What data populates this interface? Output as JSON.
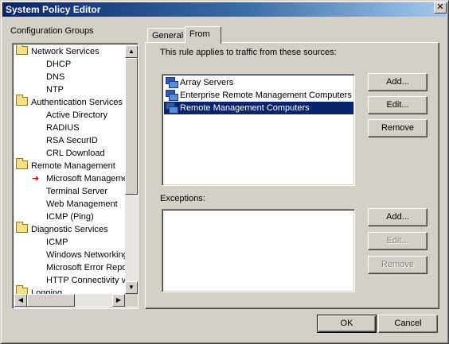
{
  "window": {
    "title": "System Policy Editor",
    "close_glyph": "✕"
  },
  "left": {
    "label": "Configuration Groups",
    "tree": [
      {
        "text": "Network Services",
        "level": 0,
        "icon": "folder-icon"
      },
      {
        "text": "DHCP",
        "level": 1
      },
      {
        "text": "DNS",
        "level": 1
      },
      {
        "text": "NTP",
        "level": 1
      },
      {
        "text": "Authentication Services",
        "level": 0,
        "icon": "folder-icon"
      },
      {
        "text": "Active Directory",
        "level": 1
      },
      {
        "text": "RADIUS",
        "level": 1
      },
      {
        "text": "RSA SecurID",
        "level": 1
      },
      {
        "text": "CRL Download",
        "level": 1
      },
      {
        "text": "Remote Management",
        "level": 0,
        "icon": "folder-icon"
      },
      {
        "text": "Microsoft Manageme",
        "level": 1,
        "marker": "red-arrow-icon"
      },
      {
        "text": "Terminal Server",
        "level": 1
      },
      {
        "text": "Web Management",
        "level": 1
      },
      {
        "text": "ICMP (Ping)",
        "level": 1
      },
      {
        "text": "Diagnostic Services",
        "level": 0,
        "icon": "folder-icon"
      },
      {
        "text": "ICMP",
        "level": 1
      },
      {
        "text": "Windows Networking",
        "level": 1
      },
      {
        "text": "Microsoft Error Repo",
        "level": 1
      },
      {
        "text": "HTTP Connectivity ve",
        "level": 1
      },
      {
        "text": "Logging",
        "level": 0,
        "icon": "folder-icon"
      }
    ]
  },
  "tabs": [
    {
      "label": "General",
      "active": false
    },
    {
      "label": "From",
      "active": true
    }
  ],
  "from_panel": {
    "intro": "This rule applies to traffic from these sources:",
    "sources": [
      {
        "text": "Array Servers",
        "selected": false
      },
      {
        "text": "Enterprise Remote Management Computers",
        "selected": false
      },
      {
        "text": "Remote Management Computers",
        "selected": true
      }
    ],
    "source_buttons": {
      "add": "Add...",
      "edit": "Edit...",
      "remove": "Remove"
    },
    "exceptions_label": "Exceptions:",
    "exceptions": [],
    "exception_buttons": {
      "add": "Add...",
      "edit": "Edit...",
      "remove": "Remove"
    }
  },
  "footer": {
    "ok": "OK",
    "cancel": "Cancel"
  },
  "colors": {
    "titlebar": "#0a246a",
    "selection": "#0a246a",
    "face": "#d4d0c8",
    "marker": "#c00000"
  }
}
